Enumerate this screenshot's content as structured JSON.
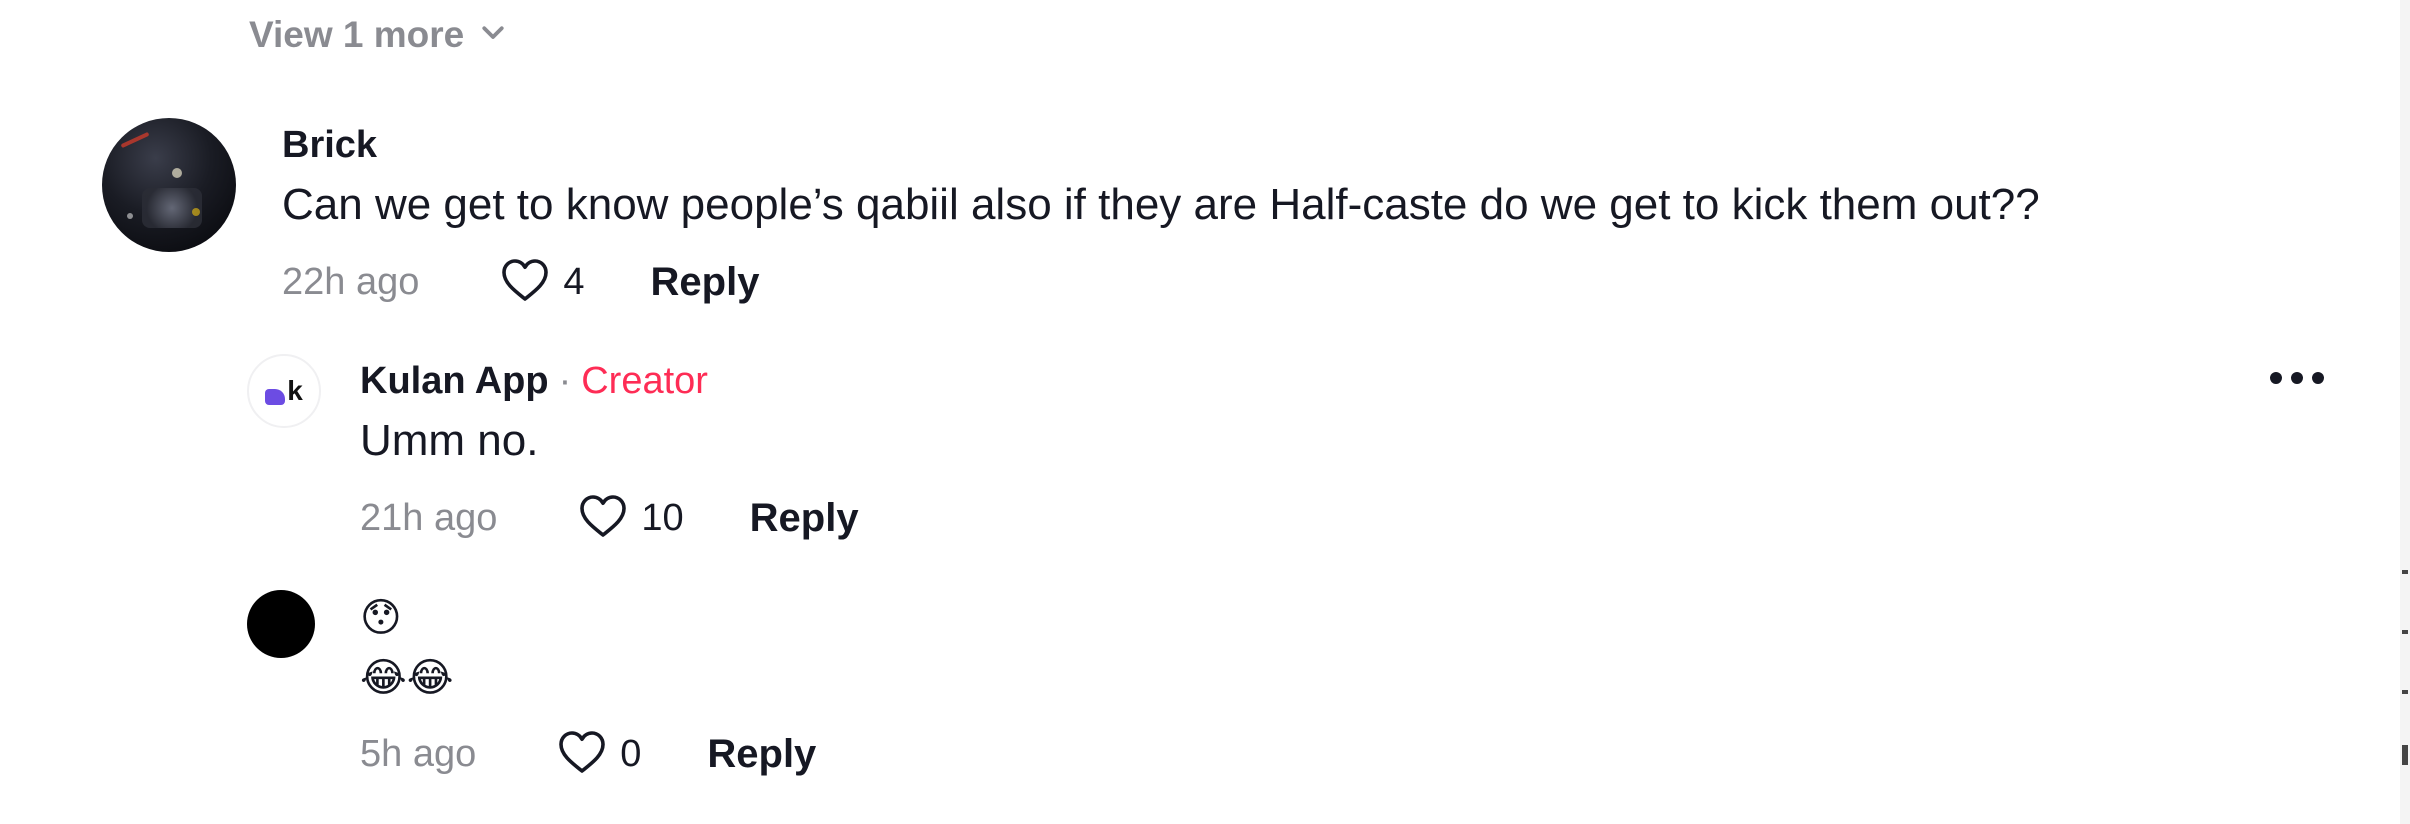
{
  "thread": {
    "view_more_label": "View 1 more"
  },
  "comments": [
    {
      "username": "Brick",
      "text": "Can we get to know people’s qabiil also if they are Half-caste do we get to kick them out??",
      "time": "22h ago",
      "likes": "4",
      "reply_label": "Reply"
    },
    {
      "username": "Kulan App",
      "separator": "·",
      "badge": "Creator",
      "text": "Umm no.",
      "time": "21h ago",
      "likes": "10",
      "reply_label": "Reply"
    },
    {
      "username": "",
      "emoji_line_1": "😯",
      "emoji_line_2": "😂😂",
      "time": "5h ago",
      "likes": "0",
      "reply_label": "Reply"
    }
  ],
  "icons": {
    "like": "heart-outline-icon",
    "expand": "chevron-down-icon",
    "more": "more-horizontal-icon"
  },
  "colors": {
    "creator_badge": "#fe2c55",
    "muted_text": "#8a8b91",
    "primary_text": "#161823",
    "kulan_logo": "#6c4ce3"
  }
}
